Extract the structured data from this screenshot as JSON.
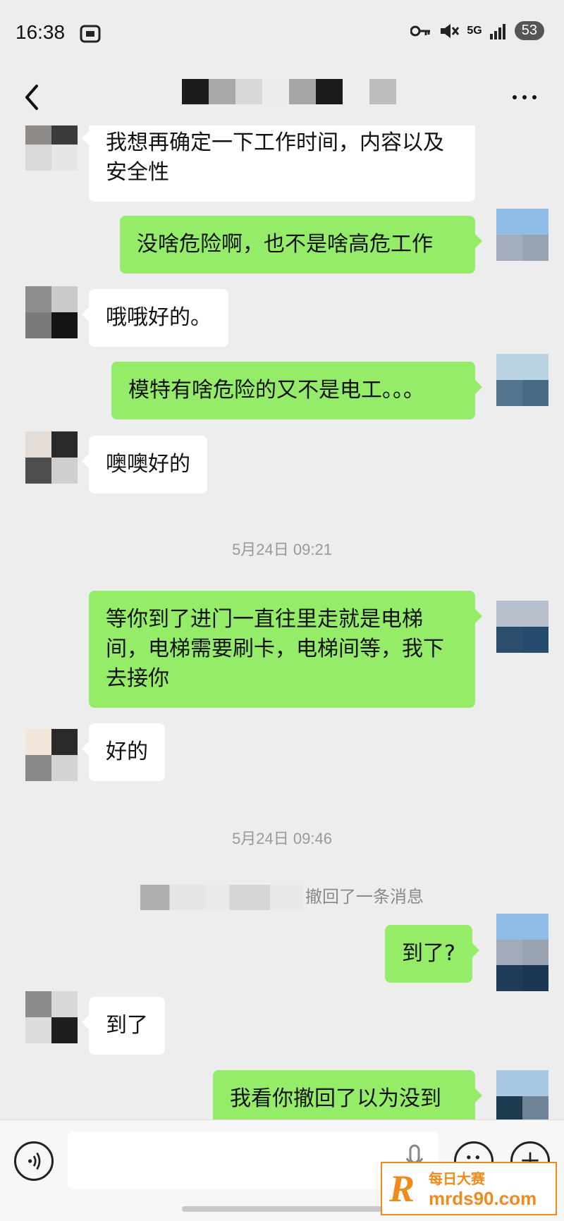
{
  "status_bar": {
    "time": "16:38",
    "network": "5G",
    "battery": "53"
  },
  "messages": [
    {
      "side": "in",
      "text": "我想再确定一下工作时间，内容以及安全性"
    },
    {
      "side": "out",
      "text": "没啥危险啊，也不是啥高危工作"
    },
    {
      "side": "in",
      "text": "哦哦好的。"
    },
    {
      "side": "out",
      "text": "模特有啥危险的又不是电工。。。"
    },
    {
      "side": "in",
      "text": "噢噢好的"
    },
    {
      "side": "out",
      "text": "等你到了进门一直往里走就是电梯间，电梯需要刷卡，电梯间等，我下去接你"
    },
    {
      "side": "in",
      "text": "好的"
    },
    {
      "side": "out",
      "text": "到了?"
    },
    {
      "side": "in",
      "text": "到了"
    },
    {
      "side": "out",
      "text": "我看你撤回了以为没到"
    }
  ],
  "timestamps": [
    "5月24日 09:21",
    "5月24日 09:46"
  ],
  "system_notice": "撤回了一条消息",
  "watermark": {
    "logo": "R",
    "title": "每日大赛",
    "url": "mrds90.com"
  },
  "colors": {
    "background": "#ededed",
    "outgoing_bubble": "#95ec69",
    "incoming_bubble": "#ffffff",
    "watermark": "#f08a1c"
  }
}
